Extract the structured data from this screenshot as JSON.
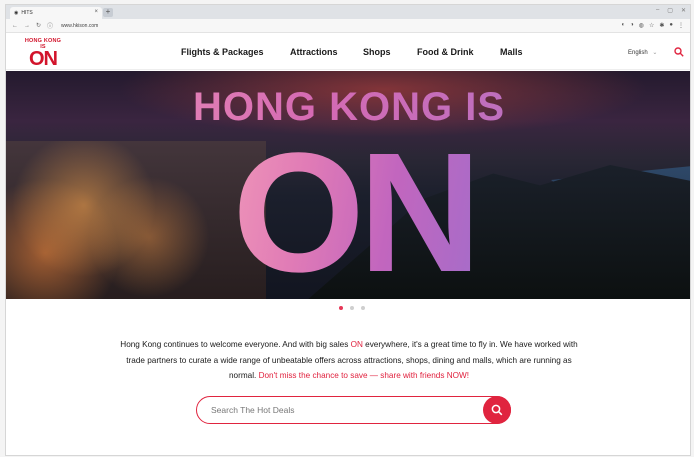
{
  "browser": {
    "tab_title": "HITS",
    "tab_close": "×",
    "new_tab": "+",
    "url": "www.hkison.com"
  },
  "site": {
    "logo_top": "HONG KONG IS",
    "logo_main": "ON",
    "nav": [
      "Flights & Packages",
      "Attractions",
      "Shops",
      "Food & Drink",
      "Malls"
    ],
    "language": "English",
    "language_caret": "⌄"
  },
  "hero": {
    "headline_line1": "HONG KONG IS",
    "headline_line2": "ON",
    "carousel_slides": 3,
    "active_slide": 1
  },
  "intro": {
    "part1": "Hong Kong continues to welcome everyone. And with big sales ",
    "highlight": "ON",
    "part2": " everywhere, it's a great time to fly in. We have worked with trade partners to curate a wide range of unbeatable offers across attractions, shops, dining and malls, which are running as normal. ",
    "cta": "Don't miss the chance to save — share with friends NOW!"
  },
  "search": {
    "placeholder": "Search The Hot Deals"
  },
  "colors": {
    "brand_red": "#e0243f",
    "nav_text": "#1a1a1a"
  }
}
